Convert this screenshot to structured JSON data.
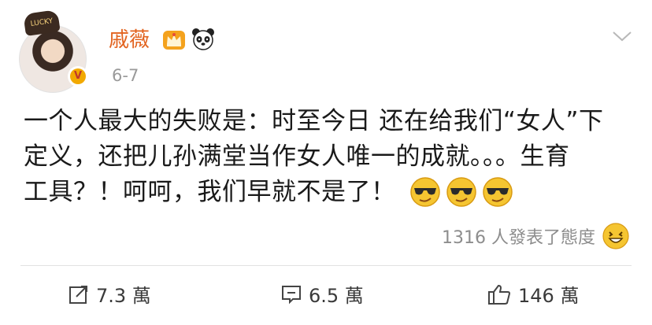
{
  "user": {
    "name": "戚薇",
    "avatar_badge_text": "LUCKY",
    "verified_badge": "V"
  },
  "post": {
    "date": "6-7",
    "text_line1": "一个人最大的失败是：时至今日 还在给我们“女人”下",
    "text_line2": "定义，还把儿孙满堂当作女人唯一的成就。。。生育",
    "text_line3": "工具？！呵呵，我们早就不是了！"
  },
  "icons": {
    "crown": "crown-icon",
    "panda": "panda-icon",
    "menu": "chevron-down-icon",
    "repost": "repost-icon",
    "comment": "comment-icon",
    "like": "thumbs-up-icon",
    "emoji": "cool-sunglasses-emoji"
  },
  "reactions": {
    "summary": "1316 人發表了態度"
  },
  "actions": {
    "repost_count": "7.3 萬",
    "comment_count": "6.5 萬",
    "like_count": "146 萬"
  },
  "colors": {
    "name_orange": "#e2631f",
    "muted_gray": "#8d8d8d",
    "emoji_yellow": "#f5c531"
  }
}
